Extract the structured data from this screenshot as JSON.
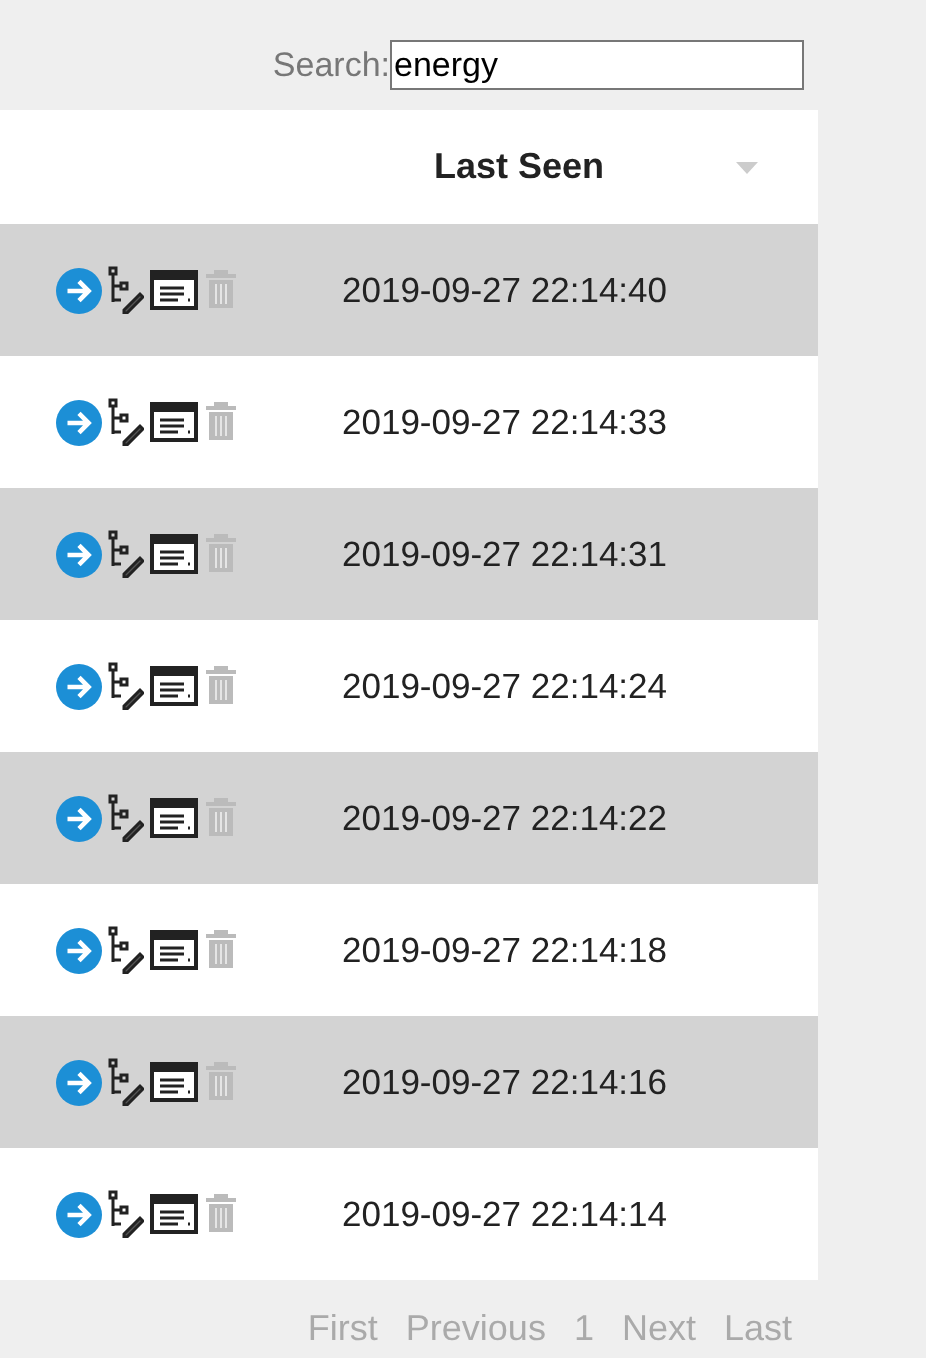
{
  "search": {
    "label": "Search:",
    "value": "energy"
  },
  "table": {
    "columns": [
      {
        "label": "Last Seen",
        "sorted": true
      }
    ],
    "rows": [
      {
        "last_seen": "2019-09-27 22:14:40",
        "delete_disabled": true
      },
      {
        "last_seen": "2019-09-27 22:14:33",
        "delete_disabled": true
      },
      {
        "last_seen": "2019-09-27 22:14:31",
        "delete_disabled": true
      },
      {
        "last_seen": "2019-09-27 22:14:24",
        "delete_disabled": true
      },
      {
        "last_seen": "2019-09-27 22:14:22",
        "delete_disabled": true
      },
      {
        "last_seen": "2019-09-27 22:14:18",
        "delete_disabled": true
      },
      {
        "last_seen": "2019-09-27 22:14:16",
        "delete_disabled": true
      },
      {
        "last_seen": "2019-09-27 22:14:14",
        "delete_disabled": true
      }
    ]
  },
  "pagination": [
    {
      "label": "First",
      "disabled": true
    },
    {
      "label": "Previous",
      "disabled": true
    },
    {
      "label": "1",
      "disabled": true
    },
    {
      "label": "Next",
      "disabled": true
    },
    {
      "label": "Last",
      "disabled": true
    }
  ]
}
